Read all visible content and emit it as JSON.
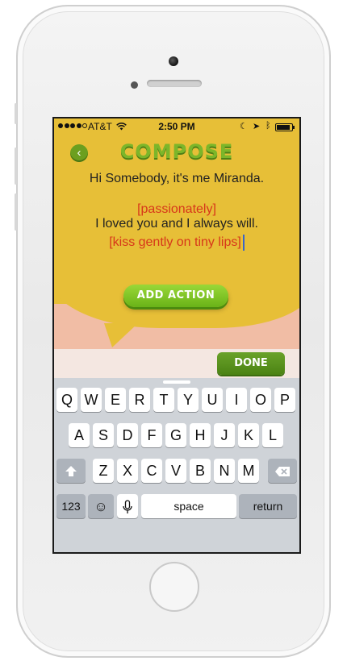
{
  "status_bar": {
    "carrier": "AT&T",
    "time": "2:50 PM"
  },
  "nav": {
    "back_icon": "‹",
    "title": "COMPOSE"
  },
  "message": {
    "line1": "Hi Somebody, it's me Miranda.",
    "action1": "[passionately]",
    "line2": "I loved you and I always will.",
    "action2": "[kiss gently on tiny lips]"
  },
  "buttons": {
    "add_action": "ADD ACTION",
    "done": "DONE"
  },
  "keyboard": {
    "row1": [
      "Q",
      "W",
      "E",
      "R",
      "T",
      "Y",
      "U",
      "I",
      "O",
      "P"
    ],
    "row2": [
      "A",
      "S",
      "D",
      "F",
      "G",
      "H",
      "J",
      "K",
      "L"
    ],
    "row3": [
      "Z",
      "X",
      "C",
      "V",
      "B",
      "N",
      "M"
    ],
    "numbers": "123",
    "space": "space",
    "return": "return"
  },
  "colors": {
    "background": "#e7bf37",
    "accent_green": "#7cb62a",
    "action_red": "#d7371a"
  }
}
